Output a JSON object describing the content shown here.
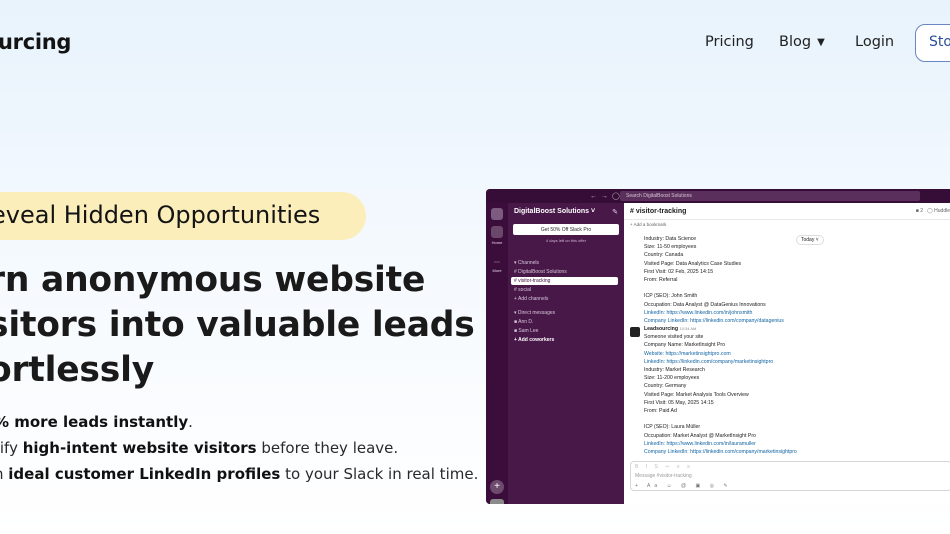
{
  "nav": {
    "logo": "urcing",
    "links": {
      "pricing": "Pricing",
      "blog": "Blog",
      "login": "Login"
    },
    "cta": "Sto"
  },
  "hero": {
    "pill": "eveal Hidden Opportunities",
    "headline": [
      "rn anonymous website",
      "sitors into valuable leads",
      "ortlessly"
    ],
    "bullets": [
      {
        "pre": "",
        "bold": "% more leads instantly",
        "post": "."
      },
      {
        "pre": "tify ",
        "bold": "high-intent website visitors",
        "post": " before they leave."
      },
      {
        "pre": "h ",
        "bold": "ideal customer LinkedIn profiles",
        "post": " to your Slack in real time."
      }
    ]
  },
  "slack": {
    "search": "Search DigitalBoost Solutions",
    "rail": {
      "home": "Home",
      "more": "More"
    },
    "workspace": "DigitalBoost Solutions",
    "promo": "Get 50% Off Slack Pro",
    "promo_sub": "4 days left on this offer",
    "sidebar": {
      "channels_header": "Channels",
      "channels": [
        "DigitalBoost Solutions",
        "visitor-tracking",
        "social"
      ],
      "add_channels": "Add channels",
      "dm_header": "Direct messages",
      "dms": [
        "Ann D.",
        "Sam Lee"
      ],
      "add_coworkers": "Add coworkers"
    },
    "channel": {
      "name": "# visitor-tracking",
      "members": "2",
      "huddle": "Huddle",
      "bookmark": "+ Add a bookmark",
      "today": "Today"
    },
    "message1": [
      "Industry: Data Science",
      "Size: 11-50 employees",
      "Country: Canada",
      "Visited Page: Data Analytics Case Studies",
      "First Visit: 02 Feb, 2025 14:15",
      "From: Referral",
      "",
      "ICP (SEO): John Smith",
      "Occupation: Data Analyst @ DataGenius Innovations",
      "LinkedIn: https://www.linkedin.com/in/johnsmith",
      "Company LinkedIn: https://linkedin.com/company/datagenius"
    ],
    "message2": {
      "sender": "Leadsourcing",
      "time": "10:34 AM",
      "lines": [
        "Someone visited your site",
        "Company Name: MarketInsight Pro",
        "Website: https://marketinsightpro.com",
        "LinkedIn: https://linkedin.com/company/marketinsightpro",
        "Industry: Market Research",
        "Size: 11-200 employees",
        "Country: Germany",
        "Visited Page: Market Analysis Tools Overview",
        "First Visit: 05 May, 2025 14:15",
        "From: Paid Ad",
        "",
        "ICP (SEO): Laura Müller",
        "Occupation: Market Analyst @ MarketInsight Pro",
        "LinkedIn: https://www.linkedin.com/in/lauramuller",
        "Company LinkedIn: https://linkedin.com/company/marketinsightpro"
      ]
    },
    "composer_placeholder": "Message #visitor-tracking"
  }
}
